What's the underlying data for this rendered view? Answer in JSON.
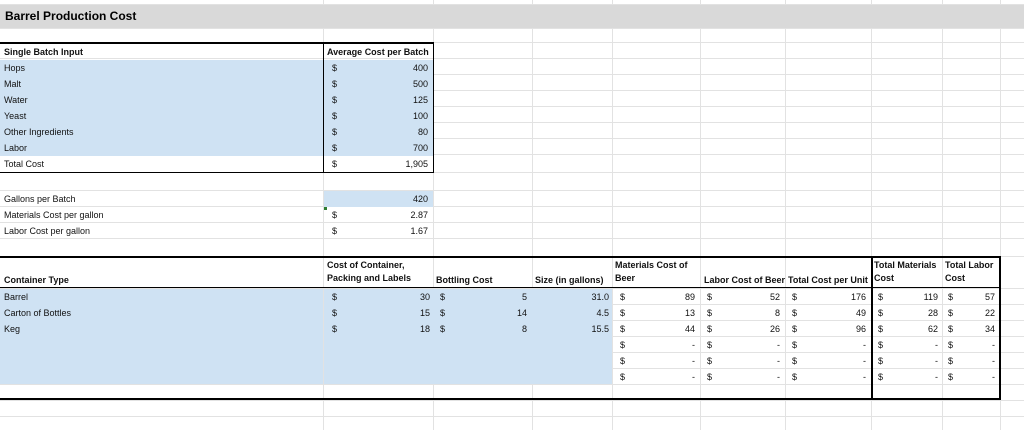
{
  "sheet": {
    "title": "Barrel Production Cost"
  },
  "batch": {
    "header_label": "Single Batch Input",
    "header_cost": "Average Cost per Batch",
    "currency": "$",
    "rows": [
      {
        "label": "Hops",
        "value": "400"
      },
      {
        "label": "Malt",
        "value": "500"
      },
      {
        "label": "Water",
        "value": "125"
      },
      {
        "label": "Yeast",
        "value": "100"
      },
      {
        "label": "Other Ingredients",
        "value": "80"
      },
      {
        "label": "Labor",
        "value": "700"
      },
      {
        "label": "Total Cost",
        "value": "1,905"
      }
    ]
  },
  "gallons": {
    "rows": [
      {
        "label": "Gallons per Batch",
        "currency": "",
        "value": "420"
      },
      {
        "label": "Materials Cost per gallon",
        "currency": "$",
        "value": "2.87"
      },
      {
        "label": "Labor Cost per gallon",
        "currency": "$",
        "value": "1.67"
      }
    ]
  },
  "containers": {
    "headers": {
      "type": "Container Type",
      "cost_container": "Cost of Container, Packing and Labels",
      "bottling": "Bottling Cost",
      "size": "Size (in gallons)",
      "materials": "Materials Cost of Beer",
      "labor": "Labor Cost of Beer",
      "total_unit": "Total Cost per Unit",
      "total_materials": "Total Materials Cost",
      "total_labor": "Total Labor Cost"
    },
    "rows": [
      {
        "type": "Barrel",
        "cost": "30",
        "bottling": "5",
        "size": "31.0",
        "materials": "89",
        "labor": "52",
        "total_unit": "176",
        "total_materials": "119",
        "total_labor": "57"
      },
      {
        "type": "Carton of Bottles",
        "cost": "15",
        "bottling": "14",
        "size": "4.5",
        "materials": "13",
        "labor": "8",
        "total_unit": "49",
        "total_materials": "28",
        "total_labor": "22"
      },
      {
        "type": "Keg",
        "cost": "18",
        "bottling": "8",
        "size": "15.5",
        "materials": "44",
        "labor": "26",
        "total_unit": "96",
        "total_materials": "62",
        "total_labor": "34"
      },
      {
        "type": "",
        "cost": "",
        "bottling": "",
        "size": "",
        "materials": "-",
        "labor": "-",
        "total_unit": "-",
        "total_materials": "-",
        "total_labor": "-"
      },
      {
        "type": "",
        "cost": "",
        "bottling": "",
        "size": "",
        "materials": "-",
        "labor": "-",
        "total_unit": "-",
        "total_materials": "-",
        "total_labor": "-"
      },
      {
        "type": "",
        "cost": "",
        "bottling": "",
        "size": "",
        "materials": "-",
        "labor": "-",
        "total_unit": "-",
        "total_materials": "-",
        "total_labor": "-"
      }
    ]
  }
}
